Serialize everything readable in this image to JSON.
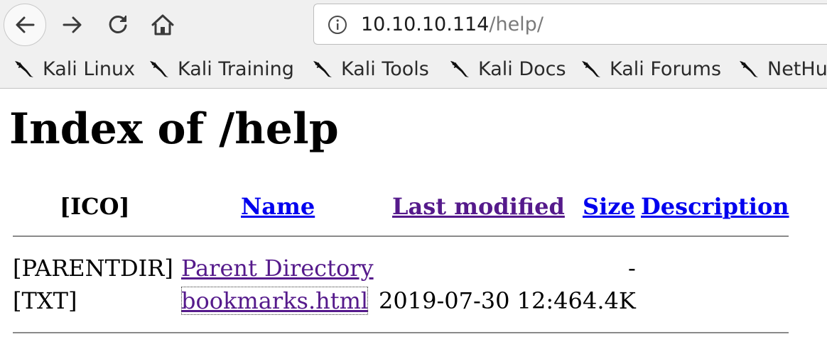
{
  "browser": {
    "url_host": "10.10.10.114",
    "url_path": "/help/",
    "bookmarks": [
      {
        "label": "Kali Linux",
        "icon": "kali-dragon-icon"
      },
      {
        "label": "Kali Training",
        "icon": "kali-dragon-icon"
      },
      {
        "label": "Kali Tools",
        "icon": "kali-dragon-icon"
      },
      {
        "label": "Kali Docs",
        "icon": "kali-dragon-icon"
      },
      {
        "label": "Kali Forums",
        "icon": "kali-dragon-icon"
      },
      {
        "label": "NetHu",
        "icon": "kali-dragon-icon"
      }
    ]
  },
  "page": {
    "title": "Index of /help",
    "headers": {
      "icon": "[ICO]",
      "name": "Name",
      "modified": "Last modified",
      "size": "Size",
      "description": "Description"
    },
    "rows": [
      {
        "icon": "[PARENTDIR]",
        "name": "Parent Directory",
        "modified": "",
        "size": "-",
        "description": ""
      },
      {
        "icon": "[TXT]",
        "name": "bookmarks.html",
        "modified": "2019-07-30 12:46",
        "size": "4.4K",
        "description": ""
      }
    ]
  },
  "colors": {
    "link": "#0000ee",
    "visited_link": "#551a8b",
    "chrome_bg": "#f0f0f0"
  }
}
